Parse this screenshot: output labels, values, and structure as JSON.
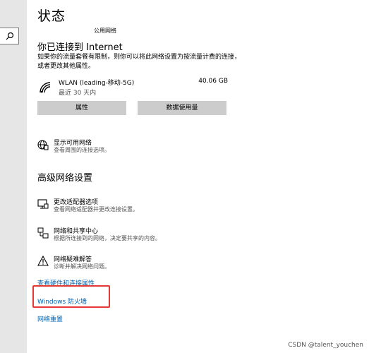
{
  "page": {
    "title": "状态",
    "network_type": "公用网络"
  },
  "connection": {
    "heading": "你已连接到 Internet",
    "description": "如果你的流量套餐有限制，则你可以将此网络设置为按流量计费的连接，或者更改其他属性。",
    "wifi_name": "WLAN (leading-移动-5G)",
    "wifi_time": "最近 30 天内",
    "wifi_usage": "40.06 GB"
  },
  "buttons": {
    "properties": "属性",
    "data_usage": "数据使用量"
  },
  "show_networks": {
    "title": "显示可用网络",
    "subtitle": "查看周围的连接选项。"
  },
  "advanced": {
    "heading": "高级网络设置",
    "items": [
      {
        "title": "更改适配器选项",
        "subtitle": "查看网络适配器并更改连接设置。"
      },
      {
        "title": "网络和共享中心",
        "subtitle": "根据所连接到的网络，决定要共享的内容。"
      },
      {
        "title": "网络疑难解答",
        "subtitle": "诊断并解决网络问题。"
      }
    ]
  },
  "links": {
    "hardware": "查看硬件和连接属性",
    "firewall": "Windows 防火墙",
    "reset": "网络重置"
  },
  "watermark": "CSDN @talent_youchen"
}
